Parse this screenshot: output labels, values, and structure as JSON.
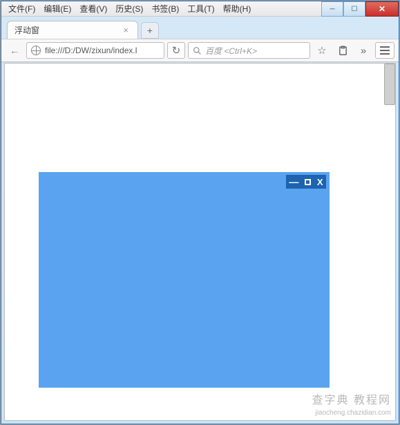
{
  "window": {
    "caption_min": "─",
    "caption_max": "☐",
    "caption_close": "✕"
  },
  "menu": {
    "file": "文件(F)",
    "edit": "编辑(E)",
    "view": "查看(V)",
    "history": "历史(S)",
    "bookmarks": "书签(B)",
    "tools": "工具(T)",
    "help": "帮助(H)"
  },
  "tab": {
    "title": "浮动窗",
    "close": "×",
    "new": "+"
  },
  "toolbar": {
    "back": "←",
    "url": "file:///D:/DW/zixun/index.l",
    "reload": "↻",
    "search_placeholder": "百度 <Ctrl+K>",
    "bookmark": "☆",
    "clipboard": "⎘",
    "overflow": "»"
  },
  "float": {
    "min": "—",
    "close": "X"
  },
  "watermark": {
    "line1": "查字典  教程网",
    "line2": "jiaocheng.chazidian.com"
  }
}
